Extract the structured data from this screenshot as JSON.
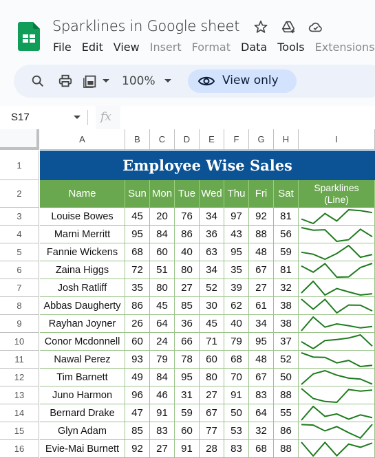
{
  "app": {
    "title": "Sparklines in Google sheet",
    "menu": [
      {
        "label": "File",
        "disabled": false
      },
      {
        "label": "Edit",
        "disabled": false
      },
      {
        "label": "View",
        "disabled": false
      },
      {
        "label": "Insert",
        "disabled": true
      },
      {
        "label": "Format",
        "disabled": true
      },
      {
        "label": "Data",
        "disabled": false
      },
      {
        "label": "Tools",
        "disabled": false
      },
      {
        "label": "Extensions",
        "disabled": true
      }
    ],
    "title_icons": [
      "star-icon",
      "add-to-drive-icon",
      "cloud-saved-icon"
    ]
  },
  "toolbar": {
    "zoom": "100%",
    "view_only_label": "View only",
    "icons": [
      "search-icon",
      "print-icon",
      "calculator-icon"
    ]
  },
  "formula_bar": {
    "cell_ref": "S17",
    "fx_label": "fx",
    "value": ""
  },
  "sheet": {
    "columns": [
      "A",
      "B",
      "C",
      "D",
      "E",
      "F",
      "G",
      "H",
      "I"
    ],
    "title": "Employee Wise Sales",
    "headers": [
      "Name",
      "Sun",
      "Mon",
      "Tue",
      "Wed",
      "Thu",
      "Fri",
      "Sat",
      "Sparklines\n(Line)"
    ],
    "header_line1": "Sparklines",
    "header_line2": "(Line)",
    "colors": {
      "title_bg": "#0b5394",
      "header_bg": "#6aa84f",
      "sparkline": "#1e7b1e"
    },
    "rows": [
      {
        "row": "3",
        "name": "Louise Bowes",
        "values": [
          45,
          20,
          76,
          34,
          97,
          92,
          81
        ]
      },
      {
        "row": "4",
        "name": "Marni Merritt",
        "values": [
          95,
          84,
          86,
          36,
          43,
          88,
          56
        ]
      },
      {
        "row": "5",
        "name": "Fannie Wickens",
        "values": [
          68,
          60,
          40,
          63,
          95,
          48,
          59
        ]
      },
      {
        "row": "6",
        "name": "Zaina Higgs",
        "values": [
          72,
          51,
          80,
          34,
          35,
          67,
          81
        ]
      },
      {
        "row": "7",
        "name": "Josh Ratliff",
        "values": [
          35,
          80,
          27,
          52,
          39,
          27,
          32
        ]
      },
      {
        "row": "8",
        "name": "Abbas Daugherty",
        "values": [
          86,
          45,
          85,
          30,
          62,
          61,
          38
        ]
      },
      {
        "row": "9",
        "name": "Rayhan Joyner",
        "values": [
          26,
          64,
          36,
          45,
          40,
          34,
          38
        ]
      },
      {
        "row": "10",
        "name": "Conor Mcdonnell",
        "values": [
          60,
          24,
          66,
          71,
          79,
          95,
          37
        ]
      },
      {
        "row": "11",
        "name": "Nawal Perez",
        "values": [
          93,
          79,
          78,
          60,
          68,
          48,
          52
        ]
      },
      {
        "row": "12",
        "name": "Tim Barnett",
        "values": [
          49,
          84,
          95,
          80,
          70,
          67,
          50
        ]
      },
      {
        "row": "13",
        "name": "Juno Harmon",
        "values": [
          96,
          46,
          31,
          27,
          91,
          83,
          88
        ]
      },
      {
        "row": "14",
        "name": "Bernard Drake",
        "values": [
          47,
          91,
          59,
          67,
          50,
          64,
          55
        ]
      },
      {
        "row": "15",
        "name": "Glyn Adam",
        "values": [
          85,
          83,
          60,
          77,
          53,
          32,
          86
        ]
      },
      {
        "row": "16",
        "name": "Evie-Mai Burnett",
        "values": [
          92,
          27,
          91,
          28,
          83,
          68,
          88
        ]
      }
    ]
  }
}
